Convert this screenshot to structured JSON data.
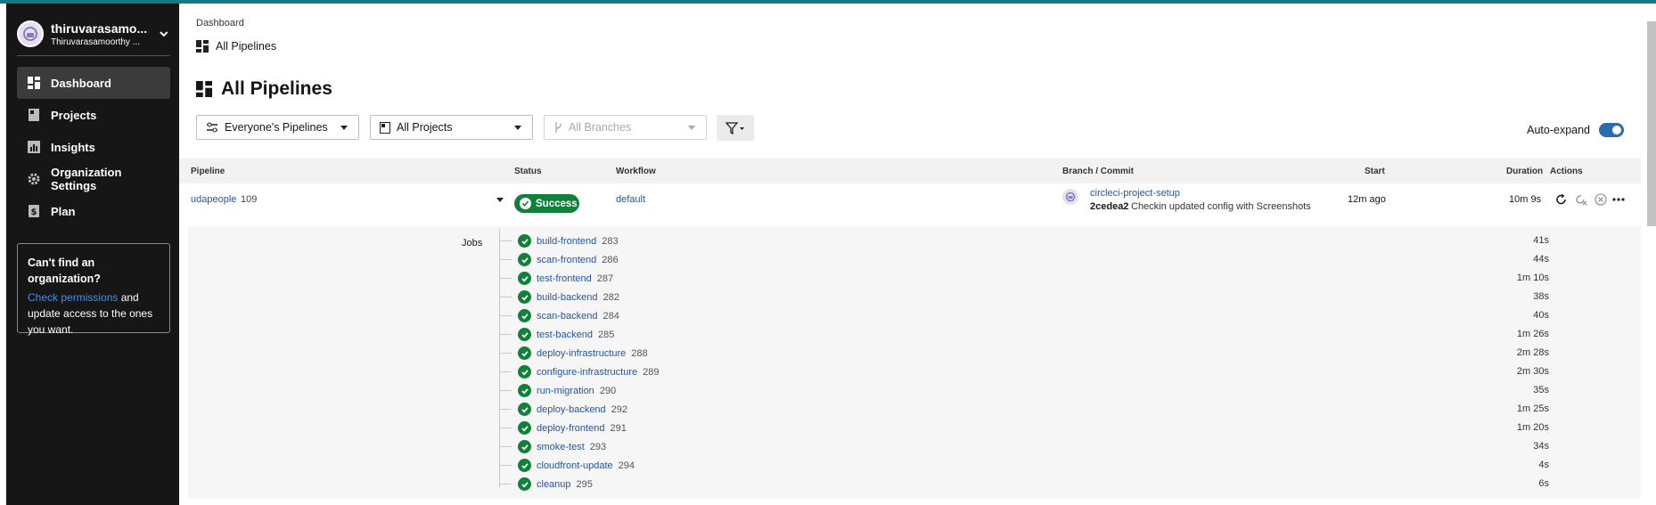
{
  "org": {
    "name": "thiruvarasamo...",
    "subtitle": "Thiruvarasamoorthy ..."
  },
  "nav": [
    {
      "label": "Dashboard",
      "icon": "dashboard-icon"
    },
    {
      "label": "Projects",
      "icon": "projects-icon"
    },
    {
      "label": "Insights",
      "icon": "insights-icon"
    },
    {
      "label": "Organization Settings",
      "icon": "gear-icon"
    },
    {
      "label": "Plan",
      "icon": "plan-icon"
    }
  ],
  "help": {
    "title": "Can't find an organization?",
    "link": "Check permissions",
    "text": " and update access to the ones you want."
  },
  "breadcrumb": {
    "parent": "Dashboard",
    "current": "All Pipelines"
  },
  "page_title": "All Pipelines",
  "filters": {
    "pipelines": "Everyone's Pipelines",
    "projects": "All Projects",
    "branches": "All Branches"
  },
  "auto_expand_label": "Auto-expand",
  "table": {
    "headers": {
      "pipeline": "Pipeline",
      "status": "Status",
      "workflow": "Workflow",
      "branch": "Branch / Commit",
      "start": "Start",
      "duration": "Duration",
      "actions": "Actions"
    },
    "row": {
      "project": "udapeople",
      "number": "109",
      "status": "Success",
      "workflow": "default",
      "branch": "circleci-project-setup",
      "commit_hash": "2cedea2",
      "commit_msg": "Checkin updated config with Screenshots",
      "start": "12m ago",
      "duration": "10m 9s"
    }
  },
  "jobs_label": "Jobs",
  "jobs": [
    {
      "name": "build-frontend",
      "num": "283",
      "duration": "41s"
    },
    {
      "name": "scan-frontend",
      "num": "286",
      "duration": "44s"
    },
    {
      "name": "test-frontend",
      "num": "287",
      "duration": "1m 10s"
    },
    {
      "name": "build-backend",
      "num": "282",
      "duration": "38s"
    },
    {
      "name": "scan-backend",
      "num": "284",
      "duration": "40s"
    },
    {
      "name": "test-backend",
      "num": "285",
      "duration": "1m 26s"
    },
    {
      "name": "deploy-infrastructure",
      "num": "288",
      "duration": "2m 28s"
    },
    {
      "name": "configure-infrastructure",
      "num": "289",
      "duration": "2m 30s"
    },
    {
      "name": "run-migration",
      "num": "290",
      "duration": "35s"
    },
    {
      "name": "deploy-backend",
      "num": "292",
      "duration": "1m 25s"
    },
    {
      "name": "deploy-frontend",
      "num": "291",
      "duration": "1m 20s"
    },
    {
      "name": "smoke-test",
      "num": "293",
      "duration": "34s"
    },
    {
      "name": "cloudfront-update",
      "num": "294",
      "duration": "4s"
    },
    {
      "name": "cleanup",
      "num": "295",
      "duration": "6s"
    }
  ],
  "colors": {
    "topbar": "#137d7d",
    "sidebar": "#161616",
    "success": "#11813a",
    "link": "#2155a4",
    "toggle": "#2b6cb0"
  }
}
